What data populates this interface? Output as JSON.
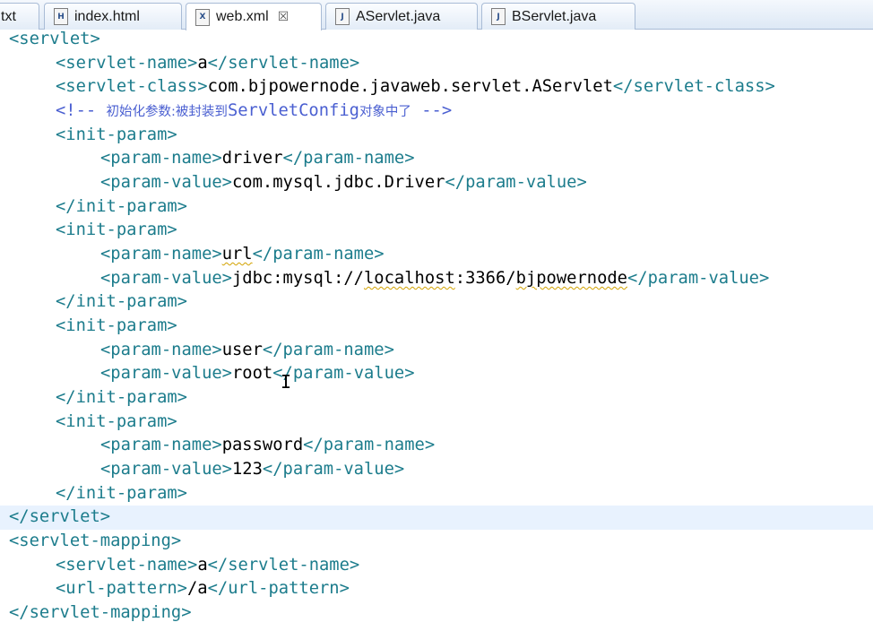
{
  "tabs": [
    {
      "label": "txt",
      "icon": "text-file-icon",
      "active": false
    },
    {
      "label": "index.html",
      "icon": "html-file-icon",
      "active": false
    },
    {
      "label": "web.xml",
      "icon": "xml-file-icon",
      "active": true,
      "close": "☒"
    },
    {
      "label": "AServlet.java",
      "icon": "java-file-icon",
      "active": false
    },
    {
      "label": "BServlet.java",
      "icon": "java-file-icon",
      "active": false
    }
  ],
  "code": {
    "l1": "<servlet>",
    "l2": [
      "<servlet-name>",
      "a",
      "</servlet-name>"
    ],
    "l3": [
      "<servlet-class>",
      "com.bjpowernode.javaweb.servlet.AServlet",
      "</servlet-class>"
    ],
    "l4": [
      "<!-- ",
      "初始化参数:被封装到",
      "ServletConfig",
      "对象中了",
      " -->"
    ],
    "ip_open": "<init-param>",
    "ip_close": "</init-param>",
    "pn_open": "<param-name>",
    "pn_close": "</param-name>",
    "pv_open": "<param-value>",
    "pv_close": "</param-value>",
    "p1_name": "driver",
    "p1_value": "com.mysql.jdbc.Driver",
    "p2_name": "url",
    "p2_value": [
      "jdbc:mysql://",
      "localhost",
      ":3366/",
      "bjpowernode"
    ],
    "p3_name": "user",
    "p3_value": "root",
    "p4_name": "password",
    "p4_value": "123",
    "servlet_close": "</servlet>",
    "mapping_open": "<servlet-mapping>",
    "sn_open": "<servlet-name>",
    "sn_value": "a",
    "sn_close": "</servlet-name>",
    "up_open": "<url-pattern>",
    "up_value": "/a",
    "up_close": "</url-pattern>",
    "mapping_close": "</servlet-mapping>"
  }
}
